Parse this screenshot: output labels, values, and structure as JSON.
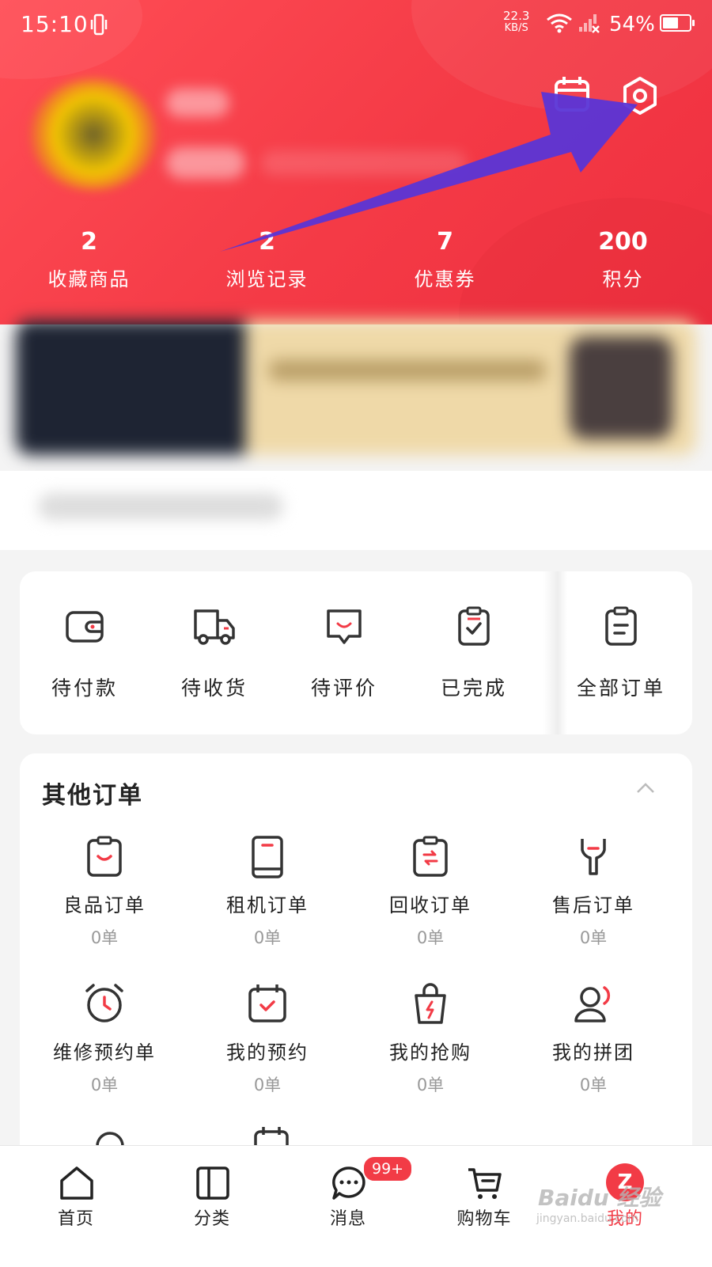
{
  "status_bar": {
    "time": "15:10",
    "speed_value": "22.3",
    "speed_unit": "KB/S",
    "battery": "54%"
  },
  "header": {
    "stats": [
      {
        "value": "2",
        "label": "收藏商品"
      },
      {
        "value": "2",
        "label": "浏览记录"
      },
      {
        "value": "7",
        "label": "优惠券"
      },
      {
        "value": "200",
        "label": "积分"
      }
    ],
    "icons": [
      "calendar-icon",
      "settings-icon"
    ],
    "accent": "#f23b46"
  },
  "orders": {
    "items": [
      {
        "label": "待付款",
        "icon": "wallet-icon"
      },
      {
        "label": "待收货",
        "icon": "truck-icon"
      },
      {
        "label": "待评价",
        "icon": "comment-icon"
      },
      {
        "label": "已完成",
        "icon": "clipboard-check-icon"
      }
    ],
    "all_label": "全部订单"
  },
  "other_orders": {
    "title": "其他订单",
    "items": [
      {
        "label": "良品订单",
        "count": "0单",
        "icon": "smile-clipboard-icon"
      },
      {
        "label": "租机订单",
        "count": "0单",
        "icon": "phone-icon"
      },
      {
        "label": "回收订单",
        "count": "0单",
        "icon": "recycle-clipboard-icon"
      },
      {
        "label": "售后订单",
        "count": "0单",
        "icon": "wrench-icon"
      },
      {
        "label": "维修预约单",
        "count": "0单",
        "icon": "alarm-clock-icon"
      },
      {
        "label": "我的预约",
        "count": "0单",
        "icon": "calendar-check-icon"
      },
      {
        "label": "我的抢购",
        "count": "0单",
        "icon": "shopping-bag-bolt-icon"
      },
      {
        "label": "我的拼团",
        "count": "0单",
        "icon": "user-group-icon"
      }
    ]
  },
  "tabbar": {
    "tabs": [
      {
        "label": "首页",
        "icon": "home-icon"
      },
      {
        "label": "分类",
        "icon": "category-icon"
      },
      {
        "label": "消息",
        "icon": "message-icon"
      },
      {
        "label": "购物车",
        "icon": "cart-icon"
      },
      {
        "label": "我的",
        "icon": "profile-icon"
      }
    ],
    "badge": "99+",
    "active_index": 4
  },
  "watermark": {
    "brand": "Baidu 经验",
    "url": "jingyan.baidu.com"
  }
}
